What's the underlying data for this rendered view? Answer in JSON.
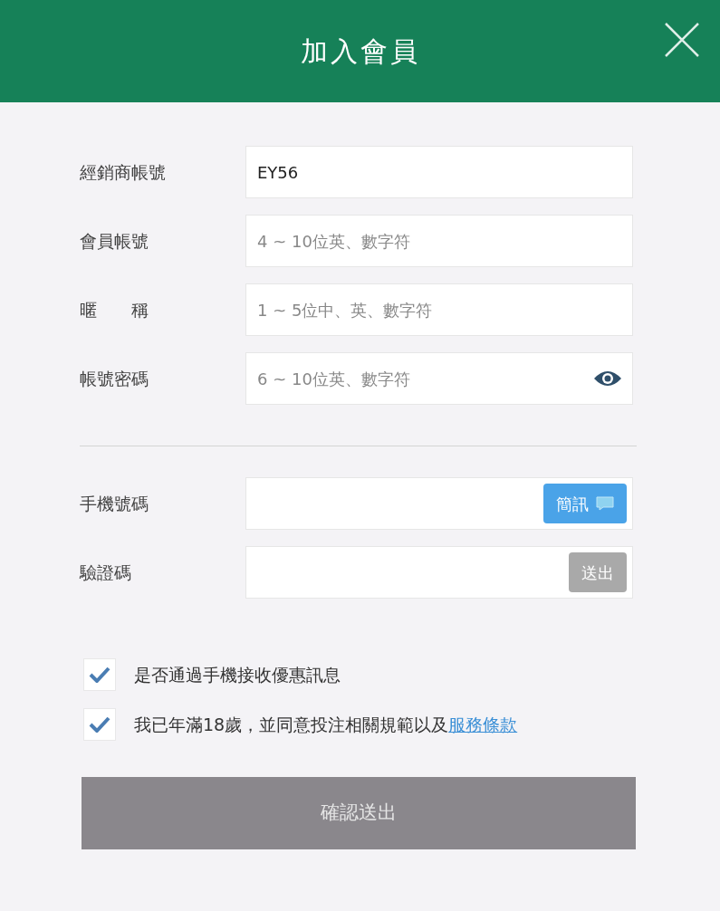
{
  "dialog": {
    "title": "加入會員"
  },
  "account_fields": [
    {
      "kind": "text",
      "label": "經銷商帳號",
      "value": "EY56"
    },
    {
      "kind": "text",
      "label": "會員帳號",
      "placeholder": "4 ~ 10位英、數字符"
    },
    {
      "kind": "text",
      "label": "暱　　稱",
      "placeholder": "1 ~ 5位中、英、數字符"
    },
    {
      "kind": "password",
      "label": "帳號密碼",
      "placeholder": "6 ~ 10位英、數字符"
    }
  ],
  "phone_fields": [
    {
      "kind": "action",
      "label": "手機號碼",
      "button": {
        "label": "簡訊",
        "disabled": false,
        "icon": true
      }
    },
    {
      "kind": "action",
      "label": "驗證碼",
      "button": {
        "label": "送出",
        "disabled": true,
        "icon": false
      }
    }
  ],
  "checkboxes": [
    {
      "text": "是否通過手機接收優惠訊息",
      "checked": true
    },
    {
      "text": "我已年滿18歲，並同意投注相關規範以及",
      "link": "服務條款",
      "checked": true
    }
  ],
  "submit": {
    "label": "確認送出",
    "disabled": true
  }
}
